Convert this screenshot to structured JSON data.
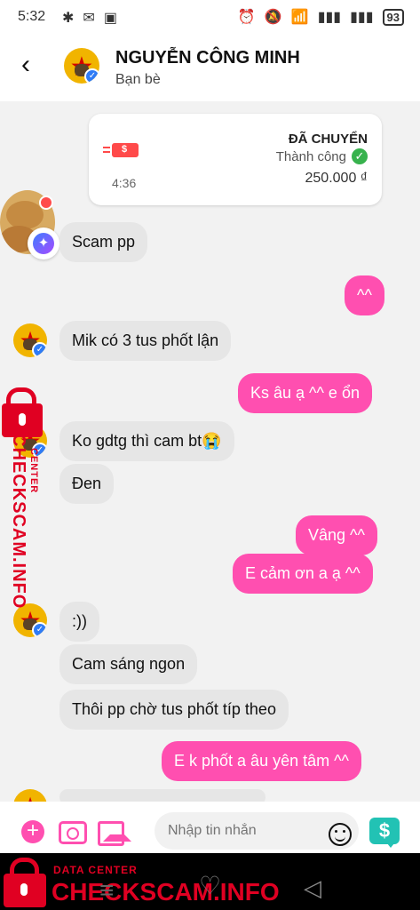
{
  "status": {
    "time": "5:32",
    "left_icons": [
      "✱",
      "✉",
      "▣"
    ],
    "right_icons": [
      "⏰",
      "🔕",
      "📶",
      "▮▮▮",
      "▮▮▮"
    ],
    "battery": "93"
  },
  "header": {
    "name": "NGUYỄN CÔNG MINH",
    "subtitle": "Bạn bè",
    "back_icon": "‹"
  },
  "transfer": {
    "status": "ĐÃ CHUYỂN",
    "success": "Thành công",
    "amount": "250.000 ₫",
    "time": "4:36",
    "money_symbol": "$"
  },
  "messages": [
    {
      "text": "Scam pp"
    },
    {
      "text": "^^"
    },
    {
      "text": "Mik có 3 tus phốt lận"
    },
    {
      "text": "Ks âu ạ ^^ e ổn"
    },
    {
      "text": "Ko gdtg thì cam bt😭"
    },
    {
      "text": "Đen"
    },
    {
      "text": "Vâng ^^"
    },
    {
      "text": "E cảm ơn a ạ ^^"
    },
    {
      "text": ":))"
    },
    {
      "text": "Cam sáng ngon"
    },
    {
      "text": "Thôi pp chờ tus phốt típ theo"
    },
    {
      "text": "E k phốt a âu yên tâm ^^"
    }
  ],
  "watermark": {
    "vertical": "CHECKSCAM.INFO",
    "center": "CENTER",
    "data_center": "DATA CENTER",
    "brand": "CHECKSCAM.INFO"
  },
  "composer": {
    "placeholder": "Nhập tin nhắn",
    "plus": "+",
    "pay": "$"
  },
  "nav": {
    "left": "≡",
    "middle": "♡",
    "right": "◁"
  }
}
